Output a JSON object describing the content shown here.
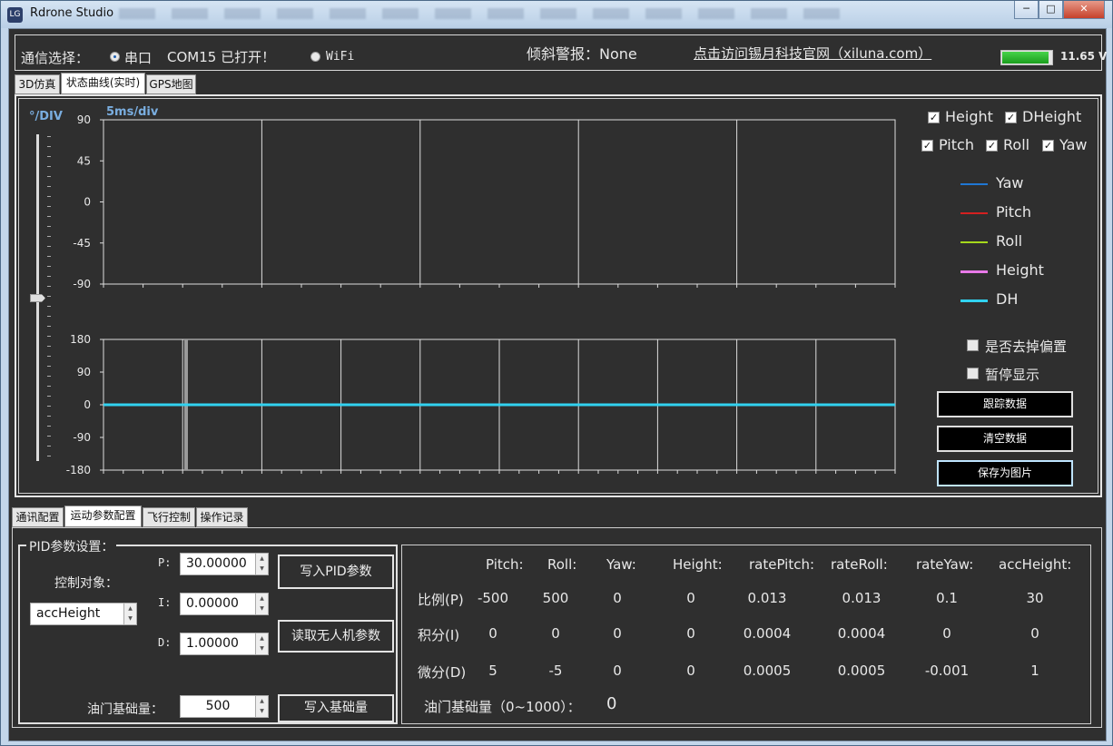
{
  "window": {
    "title": "Rdrone Studio",
    "app_icon": "LG"
  },
  "conn": {
    "label": "通信选择：",
    "serial_label": "串口",
    "com_status": "COM15 已打开！",
    "wifi_label": "WiFi",
    "tilt_alarm": "倾斜警报：None",
    "website_link": "点击访问锡月科技官网（xiluna.com）",
    "voltage": "11.65 V",
    "battery_level": 0.93
  },
  "top_tabs": [
    "3D仿真",
    "状态曲线(实时)",
    "GPS地图"
  ],
  "chart_panel": {
    "scale_label": "°/DIV",
    "time_label": "5ms/div",
    "checkboxes": [
      {
        "label": "Height",
        "checked": true
      },
      {
        "label": "DHeight",
        "checked": true
      },
      {
        "label": "Pitch",
        "checked": true
      },
      {
        "label": "Roll",
        "checked": true
      },
      {
        "label": "Yaw",
        "checked": true
      }
    ],
    "legend": [
      {
        "name": "Yaw",
        "color": "#1f77d4"
      },
      {
        "name": "Pitch",
        "color": "#d42020"
      },
      {
        "name": "Roll",
        "color": "#a6d81c"
      },
      {
        "name": "Height",
        "color": "#e879e8"
      },
      {
        "name": "DH",
        "color": "#31d2f0"
      }
    ],
    "options": [
      {
        "label": "是否去掉偏置",
        "checked": false
      },
      {
        "label": "暂停显示",
        "checked": false
      }
    ],
    "buttons": [
      "跟踪数据",
      "清空数据",
      "保存为图片"
    ],
    "slider_level": 0.5
  },
  "chart_data": [
    {
      "type": "line",
      "yticks": [
        90,
        45,
        0,
        -45,
        -90
      ],
      "ylim": [
        -90,
        90
      ],
      "series": []
    },
    {
      "type": "line",
      "yticks": [
        180,
        90,
        0,
        -90,
        -180
      ],
      "ylim": [
        -180,
        180
      ],
      "series": [
        {
          "name": "DH",
          "color": "#31d2f0",
          "values": [
            0,
            0,
            0,
            0,
            0,
            0,
            0,
            0,
            0,
            0,
            0,
            0,
            0,
            0,
            0,
            0,
            0,
            0,
            0,
            0
          ]
        }
      ]
    }
  ],
  "bottom_tabs": [
    "通讯配置",
    "运动参数配置",
    "飞行控制",
    "操作记录"
  ],
  "pid": {
    "group_title": "PID参数设置：",
    "target_label": "控制对象：",
    "target_value": "accHeight",
    "p_label": "P:",
    "p_value": "30.00000",
    "i_label": "I:",
    "i_value": "0.00000",
    "d_label": "D:",
    "d_value": "1.00000",
    "throttle_label": "油门基础量：",
    "throttle_value": "500",
    "write_pid": "写入PID参数",
    "read_params": "读取无人机参数",
    "write_base": "写入基础量"
  },
  "table": {
    "headers": [
      "Pitch:",
      "Roll:",
      "Yaw:",
      "Height:",
      "ratePitch:",
      "rateRoll:",
      "rateYaw:",
      "accHeight:"
    ],
    "rows": [
      {
        "label": "比例(P)",
        "values": [
          "-500",
          "500",
          "0",
          "0",
          "0.013",
          "0.013",
          "0.1",
          "30"
        ]
      },
      {
        "label": "积分(I)",
        "values": [
          "0",
          "0",
          "0",
          "0",
          "0.0004",
          "0.0004",
          "0",
          "0"
        ]
      },
      {
        "label": "微分(D)",
        "values": [
          "5",
          "-5",
          "0",
          "0",
          "0.0005",
          "0.0005",
          "-0.001",
          "1"
        ]
      }
    ],
    "throttle_label": "油门基础量（0~1000）：",
    "throttle_value": "0"
  }
}
